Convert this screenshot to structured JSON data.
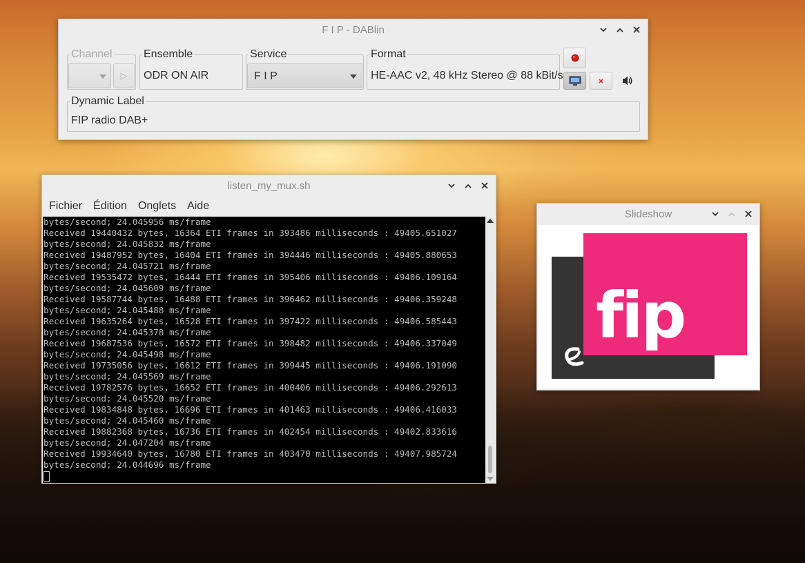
{
  "dablin": {
    "title": "F I P - DABlin",
    "channel": {
      "label": "Channel",
      "play_icon": "▷"
    },
    "ensemble": {
      "label": "Ensemble",
      "value": "ODR ON AIR"
    },
    "service": {
      "label": "Service",
      "value": "F I P"
    },
    "format": {
      "label": "Format",
      "value": "HE-AAC v2, 48 kHz Stereo @ 88 kBit/s"
    },
    "dynamic_label": {
      "label": "Dynamic Label",
      "value": "FIP radio DAB+"
    },
    "icons": {
      "record": "record-icon",
      "slideshow": "monitor-icon",
      "stop": "close-small-icon",
      "volume": "speaker-icon"
    },
    "colors": {
      "record": "#d81818"
    }
  },
  "terminal": {
    "title": "listen_my_mux.sh",
    "menu": [
      "Fichier",
      "Édition",
      "Onglets",
      "Aide"
    ],
    "lines": [
      "bytes/second; 24.045956 ms/frame",
      "Received 19440432 bytes, 16364 ETI frames in 393486 milliseconds : 49405.651027",
      "bytes/second; 24.045832 ms/frame",
      "Received 19487952 bytes, 16404 ETI frames in 394446 milliseconds : 49405.880653",
      "bytes/second; 24.045721 ms/frame",
      "Received 19535472 bytes, 16444 ETI frames in 395406 milliseconds : 49406.109164",
      "bytes/second; 24.045609 ms/frame",
      "Received 19587744 bytes, 16488 ETI frames in 396462 milliseconds : 49406.359248",
      "bytes/second; 24.045488 ms/frame",
      "Received 19635264 bytes, 16528 ETI frames in 397422 milliseconds : 49406.585443",
      "bytes/second; 24.045378 ms/frame",
      "Received 19687536 bytes, 16572 ETI frames in 398482 milliseconds : 49406.337049",
      "bytes/second; 24.045498 ms/frame",
      "Received 19735056 bytes, 16612 ETI frames in 399445 milliseconds : 49406.191090",
      "bytes/second; 24.045569 ms/frame",
      "Received 19782576 bytes, 16652 ETI frames in 400406 milliseconds : 49406.292613",
      "bytes/second; 24.045520 ms/frame",
      "Received 19834848 bytes, 16696 ETI frames in 401463 milliseconds : 49406.416033",
      "bytes/second; 24.045460 ms/frame",
      "Received 19882368 bytes, 16736 ETI frames in 402454 milliseconds : 49402.833616",
      "bytes/second; 24.047204 ms/frame",
      "Received 19934640 bytes, 16780 ETI frames in 403470 milliseconds : 49407.985724",
      "bytes/second; 24.044696 ms/frame"
    ]
  },
  "slideshow": {
    "title": "Slideshow",
    "logo_text": "fip",
    "colors": {
      "logo_pink": "#ee2a7b",
      "logo_dark": "#343434"
    }
  },
  "window_controls": {
    "minimize": "⌄",
    "maximize": "⌃",
    "close": "✕"
  }
}
